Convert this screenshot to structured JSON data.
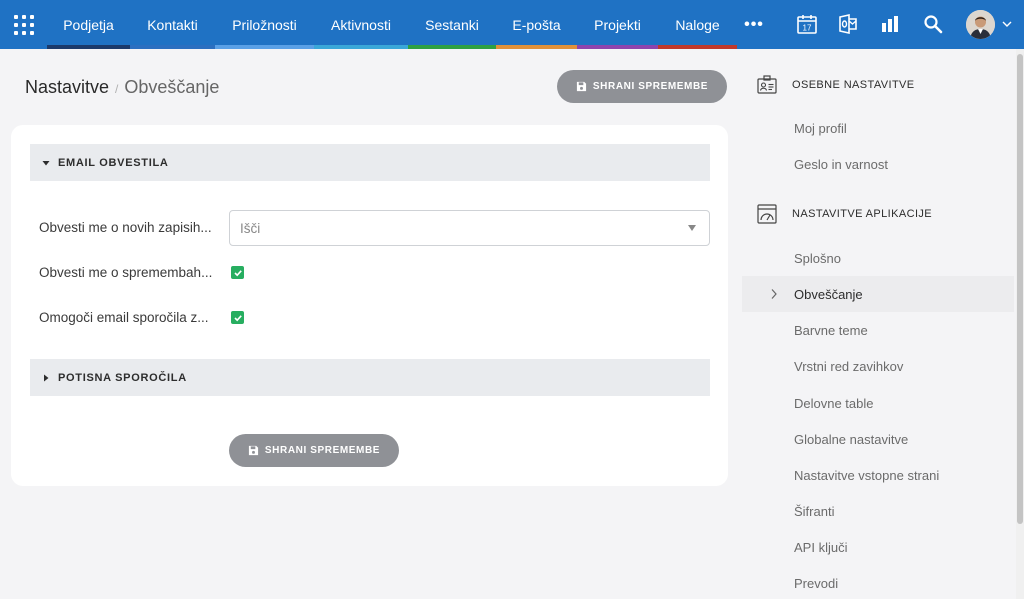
{
  "nav": {
    "items": [
      {
        "label": "Podjetja",
        "color": "#1b3a6b"
      },
      {
        "label": "Kontakti",
        "color": "#2b6fc0"
      },
      {
        "label": "Priložnosti",
        "color": "#5aa0e6"
      },
      {
        "label": "Aktivnosti",
        "color": "#3aa7d8"
      },
      {
        "label": "Sestanki",
        "color": "#2ea043"
      },
      {
        "label": "E-pošta",
        "color": "#e0913a"
      },
      {
        "label": "Projekti",
        "color": "#8e44ad"
      },
      {
        "label": "Naloge",
        "color": "#c0392b"
      }
    ],
    "more_label": "•••",
    "calendar_day": "17"
  },
  "breadcrumb": {
    "root": "Nastavitve",
    "separator": "/",
    "current": "Obveščanje"
  },
  "save_label": "SHRANI SPREMEMBE",
  "sections": {
    "email": {
      "title": "EMAIL OBVESTILA"
    },
    "push": {
      "title": "POTISNA SPOROČILA"
    }
  },
  "form": {
    "new_records_label": "Obvesti me o novih zapisih...",
    "search_placeholder": "Išči",
    "changes_label": "Obvesti me o spremembah...",
    "changes_checked": true,
    "enable_email_label": "Omogoči email sporočila z...",
    "enable_email_checked": true
  },
  "sidebar": {
    "personal_title": "OSEBNE NASTAVITVE",
    "personal_items": [
      "Moj profil",
      "Geslo in varnost"
    ],
    "app_title": "NASTAVITVE APLIKACIJE",
    "app_items": [
      "Splošno",
      "Obveščanje",
      "Barvne teme",
      "Vrstni red zavihkov",
      "Delovne table",
      "Globalne nastavitve",
      "Nastavitve vstopne strani",
      "Šifranti",
      "API ključi",
      "Prevodi"
    ],
    "active_item": "Obveščanje"
  },
  "colors": {
    "topbar": "#1f72c4",
    "check": "#27ae60",
    "button": "#8f9196"
  }
}
